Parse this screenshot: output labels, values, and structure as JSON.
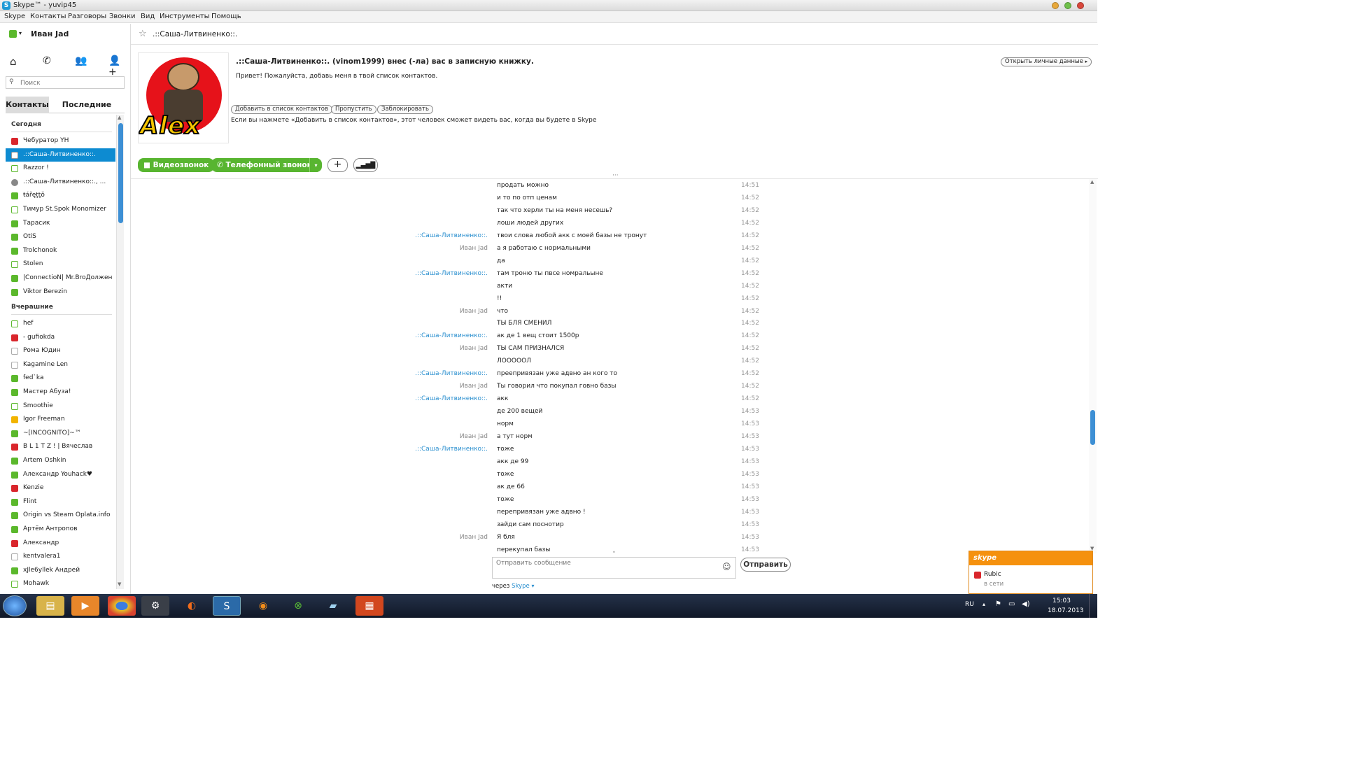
{
  "window": {
    "title": "Skype™ - yuvip45",
    "colors": {
      "accent": "#0d8bd1",
      "online": "#5bb82c",
      "busy": "#d9262c",
      "away": "#f2b400"
    }
  },
  "menu": [
    "Skype",
    "Контакты",
    "Разговоры",
    "Звонки",
    "Вид",
    "Инструменты",
    "Помощь"
  ],
  "profile": {
    "name": "Иван Jad",
    "status_icon": "online-check-icon"
  },
  "nav_icons": [
    "home-icon",
    "phone-icon",
    "contacts-icon",
    "add-contact-icon"
  ],
  "search": {
    "placeholder": "Поиск"
  },
  "tabs": {
    "contacts": "Контакты",
    "recent": "Последние"
  },
  "groups": {
    "today": "Сегодня",
    "yesterday": "Вчерашние"
  },
  "today_contacts": [
    {
      "name": "Чебуратор YH",
      "status": "busy"
    },
    {
      "name": ".::Саша-Литвиненко::.",
      "status": "request",
      "selected": true
    },
    {
      "name": "Razzor !",
      "status": "offline-online"
    },
    {
      "name": ".::Саша-Литвиненко::., ...",
      "status": "group"
    },
    {
      "name": "ŧářęţţŏ",
      "status": "online"
    },
    {
      "name": "Тимур St.Spok Monomizer",
      "status": "offline-online"
    },
    {
      "name": "Тарасик",
      "status": "online"
    },
    {
      "name": "OtiS",
      "status": "online"
    },
    {
      "name": "Trolchonok",
      "status": "online"
    },
    {
      "name": "Stolen",
      "status": "offline-online"
    },
    {
      "name": "|ConnectioN| Mr.BroДолжен",
      "status": "online"
    },
    {
      "name": "Viktor Berezin",
      "status": "online"
    }
  ],
  "yesterday_contacts": [
    {
      "name": "hef",
      "status": "offline-online"
    },
    {
      "name": "- gufiokda",
      "status": "busy"
    },
    {
      "name": "Рома Юдин",
      "status": "unknown"
    },
    {
      "name": "Kagamine Len",
      "status": "unknown"
    },
    {
      "name": "fed`ka",
      "status": "online"
    },
    {
      "name": "Мастер Абуза!",
      "status": "online"
    },
    {
      "name": "Smoothie",
      "status": "offline-online"
    },
    {
      "name": "Igor Freeman",
      "status": "away"
    },
    {
      "name": "~[INCOGNITO]~™",
      "status": "online"
    },
    {
      "name": "B L 1 T Z ! | Вячеслав",
      "status": "busy"
    },
    {
      "name": "Artem Oshkin",
      "status": "online"
    },
    {
      "name": "Александр Youhack♥",
      "status": "online"
    },
    {
      "name": "Kenzie",
      "status": "busy"
    },
    {
      "name": "Flint",
      "status": "online"
    },
    {
      "name": "Origin vs  Steam   Oplata.info",
      "status": "online"
    },
    {
      "name": "Артём Антропов",
      "status": "online"
    },
    {
      "name": "Александр",
      "status": "busy"
    },
    {
      "name": "kentvalera1",
      "status": "unknown"
    },
    {
      "name": "xJle6yllek Андрей",
      "status": "online"
    },
    {
      "name": "Mohawk",
      "status": "offline-online"
    }
  ],
  "conversation": {
    "title": ".::Саша-Литвиненко::.",
    "avatar_text": "Alex",
    "request_title": ".::Саша-Литвиненко::. (vinom1999) внес (-ла) вас в записную книжку.",
    "request_message": "Привет! Пожалуйста, добавь меня в твой список контактов.",
    "open_profile": "Открыть личные данные",
    "buttons": {
      "add": "Добавить в список контактов",
      "skip": "Пропустить",
      "block": "Заблокировать"
    },
    "hint": "Если вы нажмете «Добавить в список контактов», этот человек сможет видеть вас, когда вы будете в Skype",
    "video_call": "Видеозвонок",
    "phone_call": "Телефонный звонок"
  },
  "messages": [
    {
      "sender": "",
      "text": "продать можно",
      "time": "14:51"
    },
    {
      "sender": "",
      "text": "и то по отп ценам",
      "time": "14:52"
    },
    {
      "sender": "",
      "text": "так что херли ты на меня несешь?",
      "time": "14:52"
    },
    {
      "sender": "",
      "text": "лоши людей других",
      "time": "14:52"
    },
    {
      "sender": ".::Саша-Литвиненко::.",
      "text": "твои слова любой акк с моей базы не тронут",
      "time": "14:52",
      "other": true
    },
    {
      "sender": "Иван Jad",
      "text": "а я работаю с нормальными",
      "time": "14:52"
    },
    {
      "sender": "",
      "text": "да",
      "time": "14:52"
    },
    {
      "sender": ".::Саша-Литвиненко::.",
      "text": "там троню ты пвсе номральыне",
      "time": "14:52",
      "other": true
    },
    {
      "sender": "",
      "text": "акти",
      "time": "14:52"
    },
    {
      "sender": "",
      "text": "!!",
      "time": "14:52"
    },
    {
      "sender": "Иван Jad",
      "text": "что",
      "time": "14:52"
    },
    {
      "sender": "",
      "text": "ТЫ БЛЯ СМЕНИЛ",
      "time": "14:52"
    },
    {
      "sender": ".::Саша-Литвиненко::.",
      "text": "ак де 1 вещ стоит 1500р",
      "time": "14:52",
      "other": true
    },
    {
      "sender": "Иван Jad",
      "text": "ТЫ САМ ПРИЗНАЛСЯ",
      "time": "14:52"
    },
    {
      "sender": "",
      "text": "ЛОООООЛ",
      "time": "14:52"
    },
    {
      "sender": ".::Саша-Литвиненко::.",
      "text": "преепривязан уже адвно ан кого то",
      "time": "14:52",
      "other": true
    },
    {
      "sender": "Иван Jad",
      "text": "Ты говорил что покупал говно базы",
      "time": "14:52"
    },
    {
      "sender": ".::Саша-Литвиненко::.",
      "text": "акк",
      "time": "14:52",
      "other": true
    },
    {
      "sender": "",
      "text": "де 200 вещей",
      "time": "14:53"
    },
    {
      "sender": "",
      "text": "норм",
      "time": "14:53"
    },
    {
      "sender": "Иван Jad",
      "text": "а тут норм",
      "time": "14:53"
    },
    {
      "sender": ".::Саша-Литвиненко::.",
      "text": "тоже",
      "time": "14:53",
      "other": true
    },
    {
      "sender": "",
      "text": "акк де 99",
      "time": "14:53"
    },
    {
      "sender": "",
      "text": "тоже",
      "time": "14:53"
    },
    {
      "sender": "",
      "text": "ак де 66",
      "time": "14:53"
    },
    {
      "sender": "",
      "text": "тоже",
      "time": "14:53"
    },
    {
      "sender": "",
      "text": "перепривязан уже адвно !",
      "time": "14:53"
    },
    {
      "sender": "",
      "text": "зайди сам поснотир",
      "time": "14:53"
    },
    {
      "sender": "Иван Jad",
      "text": "Я бля",
      "time": "14:53"
    },
    {
      "sender": "",
      "text": "перекупал базы",
      "time": "14:53"
    }
  ],
  "composer": {
    "placeholder": "Отправить сообщение",
    "send": "Отправить",
    "via_label": "через",
    "via_value": "Skype"
  },
  "notification": {
    "brand": "skype",
    "name": "Rubic",
    "status": "в сети"
  },
  "taskbar": {
    "lang": "RU",
    "time": "15:03",
    "date": "18.07.2013"
  }
}
